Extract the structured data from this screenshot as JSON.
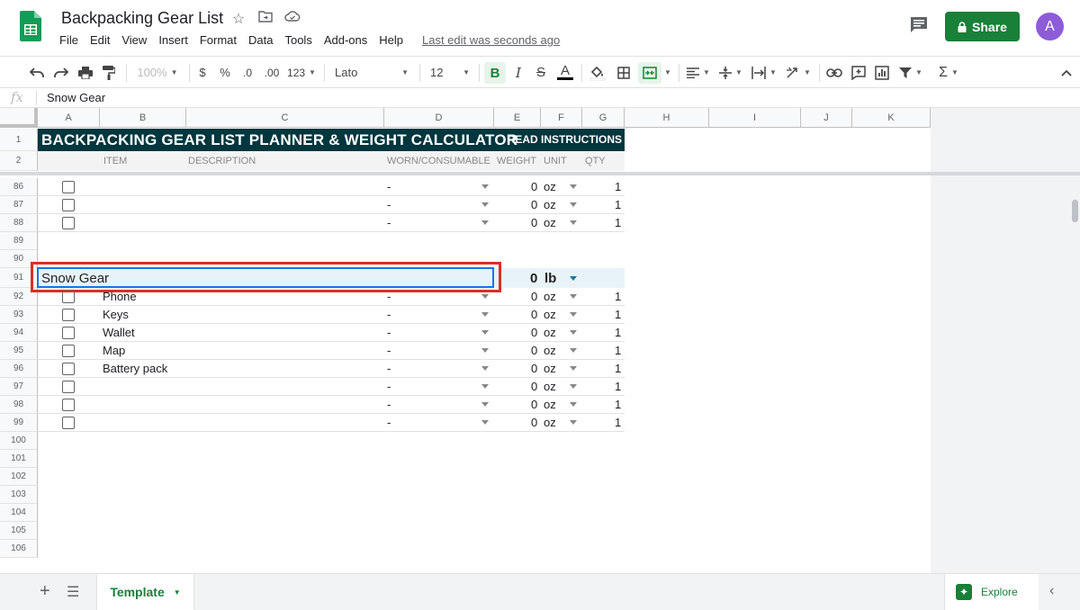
{
  "app": {
    "title": "Backpacking Gear List",
    "last_edit": "Last edit was seconds ago",
    "share_label": "Share",
    "avatar_initial": "A",
    "menu": [
      "File",
      "Edit",
      "View",
      "Insert",
      "Format",
      "Data",
      "Tools",
      "Add-ons",
      "Help"
    ]
  },
  "toolbar": {
    "zoom": "100%",
    "currency": "$",
    "percent": "%",
    "dec_less": ".0",
    "dec_more": ".00",
    "format_more": "123",
    "font": "Lato",
    "font_size": "12",
    "bold": "B",
    "italic": "I",
    "strike": "S",
    "text_color": "A"
  },
  "formula_bar": {
    "fx": "fx",
    "value": "Snow Gear"
  },
  "columns": [
    "A",
    "B",
    "C",
    "D",
    "E",
    "F",
    "G",
    "H",
    "I",
    "J",
    "K"
  ],
  "sheet": {
    "banner_title": "BACKPACKING GEAR LIST PLANNER & WEIGHT CALCULATOR",
    "banner_link": "READ INSTRUCTIONS",
    "headers": {
      "item": "ITEM",
      "description": "DESCRIPTION",
      "worn": "WORN/CONSUMABLE",
      "weight": "WEIGHT",
      "unit": "UNIT",
      "qty": "QTY"
    },
    "row_numbers": [
      "1",
      "2",
      "86",
      "87",
      "88",
      "89",
      "90",
      "91",
      "92",
      "93",
      "94",
      "95",
      "96",
      "97",
      "98",
      "99",
      "100",
      "101",
      "102",
      "103",
      "104",
      "105",
      "106"
    ],
    "rows_top": [
      {
        "item": "",
        "worn": "-",
        "weight": "0",
        "unit": "oz",
        "qty": "1"
      },
      {
        "item": "",
        "worn": "-",
        "weight": "0",
        "unit": "oz",
        "qty": "1"
      },
      {
        "item": "",
        "worn": "-",
        "weight": "0",
        "unit": "oz",
        "qty": "1"
      }
    ],
    "section": {
      "name": "Snow Gear",
      "weight": "0",
      "unit": "lb"
    },
    "rows_section": [
      {
        "item": "Phone",
        "worn": "-",
        "weight": "0",
        "unit": "oz",
        "qty": "1"
      },
      {
        "item": "Keys",
        "worn": "-",
        "weight": "0",
        "unit": "oz",
        "qty": "1"
      },
      {
        "item": "Wallet",
        "worn": "-",
        "weight": "0",
        "unit": "oz",
        "qty": "1"
      },
      {
        "item": "Map",
        "worn": "-",
        "weight": "0",
        "unit": "oz",
        "qty": "1"
      },
      {
        "item": "Battery pack",
        "worn": "-",
        "weight": "0",
        "unit": "oz",
        "qty": "1"
      },
      {
        "item": "",
        "worn": "-",
        "weight": "0",
        "unit": "oz",
        "qty": "1"
      },
      {
        "item": "",
        "worn": "-",
        "weight": "0",
        "unit": "oz",
        "qty": "1"
      },
      {
        "item": "",
        "worn": "-",
        "weight": "0",
        "unit": "oz",
        "qty": "1"
      }
    ]
  },
  "bottom": {
    "tab_name": "Template",
    "explore_label": "Explore"
  },
  "colors": {
    "brand_green": "#188038",
    "banner_bg": "#00363d",
    "selection_blue": "#1a73e8",
    "highlight_red": "#d93025",
    "section_bg": "#e8f3f8"
  }
}
